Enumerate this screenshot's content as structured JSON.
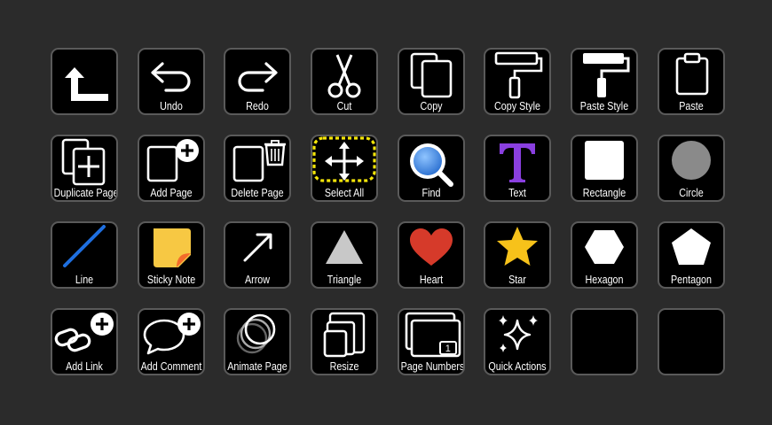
{
  "toolbar": {
    "tiles": [
      {
        "label": "",
        "icon": "back-arrow-icon"
      },
      {
        "label": "Undo",
        "icon": "undo-icon"
      },
      {
        "label": "Redo",
        "icon": "redo-icon"
      },
      {
        "label": "Cut",
        "icon": "scissors-icon"
      },
      {
        "label": "Copy",
        "icon": "copy-icon"
      },
      {
        "label": "Copy Style",
        "icon": "paint-roller-outline-icon"
      },
      {
        "label": "Paste Style",
        "icon": "paint-roller-filled-icon"
      },
      {
        "label": "Paste",
        "icon": "clipboard-icon"
      },
      {
        "label": "Duplicate Page",
        "icon": "duplicate-page-icon"
      },
      {
        "label": "Add Page",
        "icon": "add-page-icon"
      },
      {
        "label": "Delete Page",
        "icon": "delete-page-icon"
      },
      {
        "label": "Select All",
        "icon": "move-arrows-icon"
      },
      {
        "label": "Find",
        "icon": "magnifier-icon"
      },
      {
        "label": "Text",
        "icon": "text-t-icon"
      },
      {
        "label": "Rectangle",
        "icon": "rectangle-icon"
      },
      {
        "label": "Circle",
        "icon": "circle-icon"
      },
      {
        "label": "Line",
        "icon": "line-icon"
      },
      {
        "label": "Sticky Note",
        "icon": "sticky-note-icon"
      },
      {
        "label": "Arrow",
        "icon": "arrow-icon"
      },
      {
        "label": "Triangle",
        "icon": "triangle-icon"
      },
      {
        "label": "Heart",
        "icon": "heart-icon"
      },
      {
        "label": "Star",
        "icon": "star-icon"
      },
      {
        "label": "Hexagon",
        "icon": "hexagon-icon"
      },
      {
        "label": "Pentagon",
        "icon": "pentagon-icon"
      },
      {
        "label": "Add Link",
        "icon": "add-link-icon"
      },
      {
        "label": "Add Comment",
        "icon": "add-comment-icon"
      },
      {
        "label": "Animate Page",
        "icon": "animate-page-icon"
      },
      {
        "label": "Resize",
        "icon": "resize-icon"
      },
      {
        "label": "Page Numbers",
        "icon": "page-numbers-icon"
      },
      {
        "label": "Quick Actions",
        "icon": "sparkles-icon"
      },
      {
        "label": "",
        "icon": "empty-slot"
      },
      {
        "label": "",
        "icon": "empty-slot"
      }
    ],
    "page_number_badge": "1"
  },
  "colors": {
    "background": "#2b2b2b",
    "tile": "#000000",
    "tile_border": "#5a5a5a",
    "selection_dash": "#f5e60a",
    "text_icon": "#8a3fe0",
    "find_icon": "#3d8fe8",
    "line_icon": "#1e6fe0",
    "sticky_note": "#f7c843",
    "sticky_fold": "#f36b2a",
    "triangle": "#c8c8c8",
    "heart": "#d63a2a",
    "star": "#f7c21a",
    "circle": "#8a8a8a"
  }
}
